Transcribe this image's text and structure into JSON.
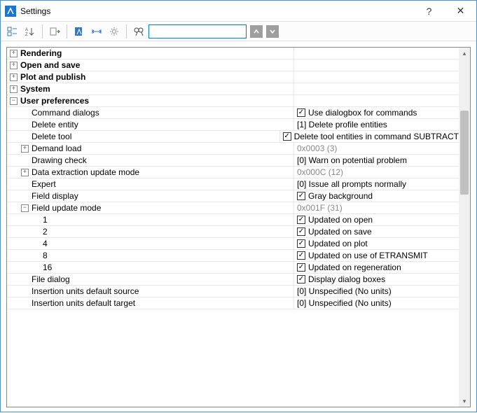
{
  "window": {
    "title": "Settings",
    "help": "?",
    "close": "✕"
  },
  "toolbar": {
    "search_placeholder": ""
  },
  "categories": {
    "rendering": "Rendering",
    "open_save": "Open and save",
    "plot_publish": "Plot and publish",
    "system": "System",
    "user_prefs": "User preferences"
  },
  "prefs": {
    "command_dialogs": {
      "label": "Command dialogs",
      "value": "Use dialogbox for commands",
      "checked": true
    },
    "delete_entity": {
      "label": "Delete entity",
      "value": "[1] Delete profile entities"
    },
    "delete_tool": {
      "label": "Delete tool",
      "value": "Delete tool entities in command SUBTRACT",
      "checked": true
    },
    "demand_load": {
      "label": "Demand load",
      "value": "0x0003 (3)"
    },
    "drawing_check": {
      "label": "Drawing check",
      "value": "[0] Warn on potential problem"
    },
    "data_extraction": {
      "label": "Data extraction update mode",
      "value": "0x000C (12)"
    },
    "expert": {
      "label": "Expert",
      "value": "[0] Issue all prompts normally"
    },
    "field_display": {
      "label": "Field display",
      "value": "Gray background",
      "checked": true
    },
    "field_update": {
      "label": "Field update mode",
      "value": "0x001F (31)"
    },
    "fu_items": [
      {
        "key": "1",
        "value": "Updated on open",
        "checked": true
      },
      {
        "key": "2",
        "value": "Updated on save",
        "checked": true
      },
      {
        "key": "4",
        "value": "Updated on plot",
        "checked": true
      },
      {
        "key": "8",
        "value": "Updated on use of ETRANSMIT",
        "checked": true
      },
      {
        "key": "16",
        "value": "Updated on regeneration",
        "checked": true
      }
    ],
    "file_dialog": {
      "label": "File dialog",
      "value": "Display dialog boxes",
      "checked": true
    },
    "ins_src": {
      "label": "Insertion units default source",
      "value": "[0] Unspecified (No units)"
    },
    "ins_tgt": {
      "label": "Insertion units default target",
      "value": "[0] Unspecified (No units)"
    }
  }
}
